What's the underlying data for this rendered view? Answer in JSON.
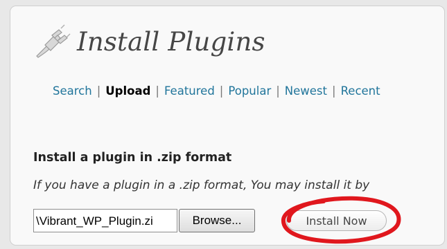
{
  "page": {
    "title": "Install Plugins",
    "title_icon": "plug-icon"
  },
  "subnav": {
    "items": [
      {
        "label": "Search",
        "current": false
      },
      {
        "label": "Upload",
        "current": true
      },
      {
        "label": "Featured",
        "current": false
      },
      {
        "label": "Popular",
        "current": false
      },
      {
        "label": "Newest",
        "current": false
      },
      {
        "label": "Recent",
        "current": false
      }
    ],
    "separator": "|"
  },
  "upload": {
    "heading": "Install a plugin in .zip format",
    "help_text": "If you have a plugin in a .zip format, You may install it by",
    "file_value": "\\Vibrant_WP_Plugin.zi",
    "browse_label": "Browse...",
    "install_label": "Install Now"
  },
  "annotation": {
    "highlight_color": "#e0171d"
  }
}
